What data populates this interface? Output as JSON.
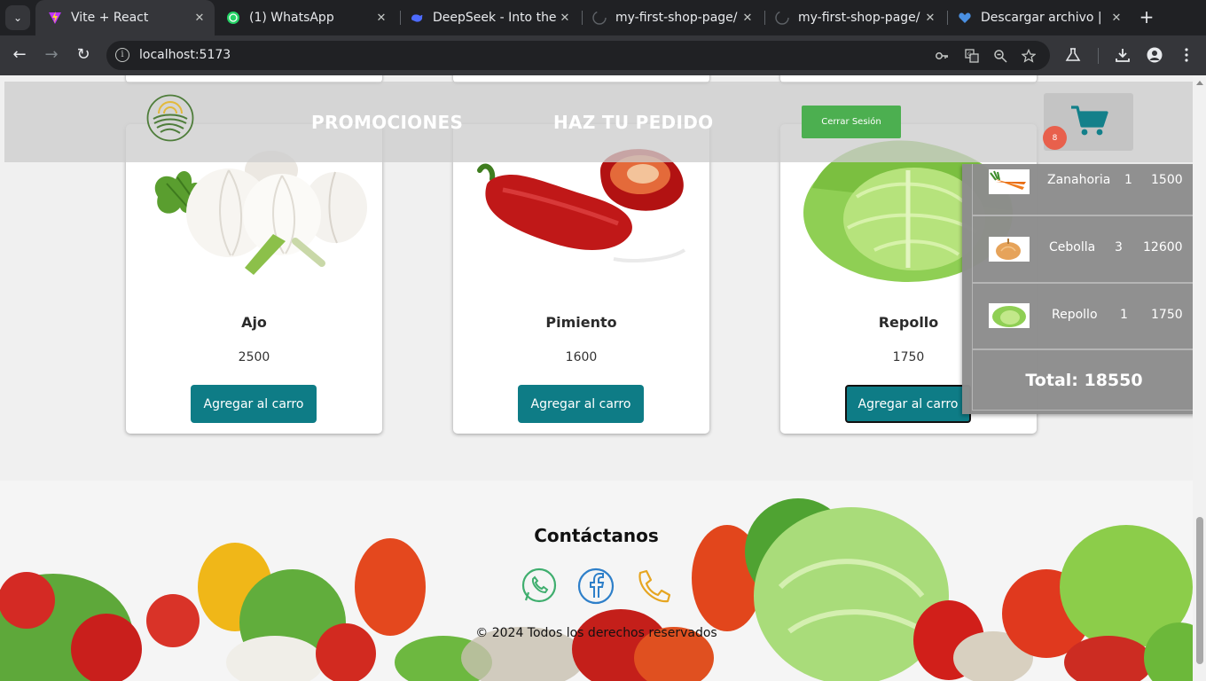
{
  "browser": {
    "tabs": [
      {
        "title": "Vite + React",
        "active": true
      },
      {
        "title": "(1) WhatsApp",
        "active": false
      },
      {
        "title": "DeepSeek - Into the",
        "active": false
      },
      {
        "title": "my-first-shop-page/",
        "active": false
      },
      {
        "title": "my-first-shop-page/",
        "active": false
      },
      {
        "title": "Descargar archivo |",
        "active": false
      }
    ],
    "url": "localhost:5173"
  },
  "header": {
    "nav": [
      "PROMOCIONES",
      "HAZ TU PEDIDO"
    ],
    "logout_label": "Cerrar Sesión",
    "cart_count": "8"
  },
  "products": [
    {
      "name": "Ajo",
      "price": "2500",
      "button": "Agregar al carro"
    },
    {
      "name": "Pimiento",
      "price": "1600",
      "button": "Agregar al carro"
    },
    {
      "name": "Repollo",
      "price": "1750",
      "button": "Agregar al carro"
    }
  ],
  "cart": {
    "items": [
      {
        "name": "Zanahoria",
        "qty": "1",
        "subtotal": "1500"
      },
      {
        "name": "Cebolla",
        "qty": "3",
        "subtotal": "12600"
      },
      {
        "name": "Repollo",
        "qty": "1",
        "subtotal": "1750"
      }
    ],
    "total": "Total: 18550"
  },
  "footer": {
    "title": "Contáctanos",
    "copyright": "© 2024 Todos los derechos reservados",
    "icons": [
      "whatsapp-icon",
      "facebook-icon",
      "phone-icon"
    ]
  },
  "colors": {
    "accent_button": "#0e7c86",
    "logout_button": "#4caf50",
    "cart_badge": "#e8604c",
    "cart_icon": "#13808a"
  }
}
